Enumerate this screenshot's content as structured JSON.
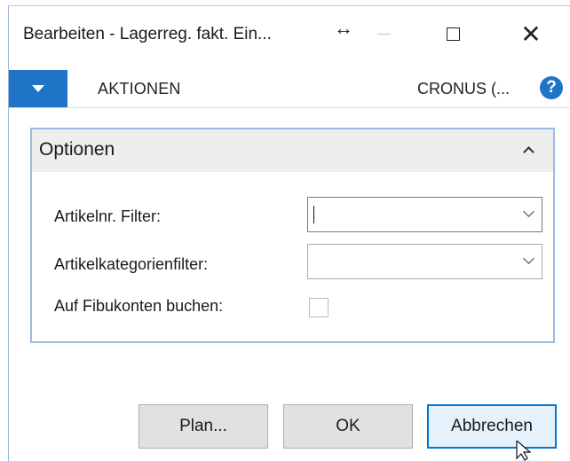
{
  "window": {
    "title": "Bearbeiten - Lagerreg. fakt. Ein...",
    "resize_glyph": "↔",
    "close_glyph": "✕"
  },
  "ribbon": {
    "tab_label": "AKTIONEN",
    "company": "CRONUS (...",
    "help_glyph": "?"
  },
  "options": {
    "title": "Optionen",
    "fields": [
      {
        "label": "Artikelnr. Filter:",
        "value": "",
        "type": "dropdown",
        "focused": true
      },
      {
        "label": "Artikelkategorienfilter:",
        "value": "",
        "type": "dropdown",
        "focused": false
      },
      {
        "label": "Auf Fibukonten buchen:",
        "checked": false,
        "type": "checkbox"
      }
    ]
  },
  "buttons": {
    "plan": "Plan...",
    "ok": "OK",
    "cancel": "Abbrechen"
  },
  "colors": {
    "accent": "#1f74c7",
    "fasttab_border": "#9bbbe3",
    "primary_border": "#0078d7"
  }
}
